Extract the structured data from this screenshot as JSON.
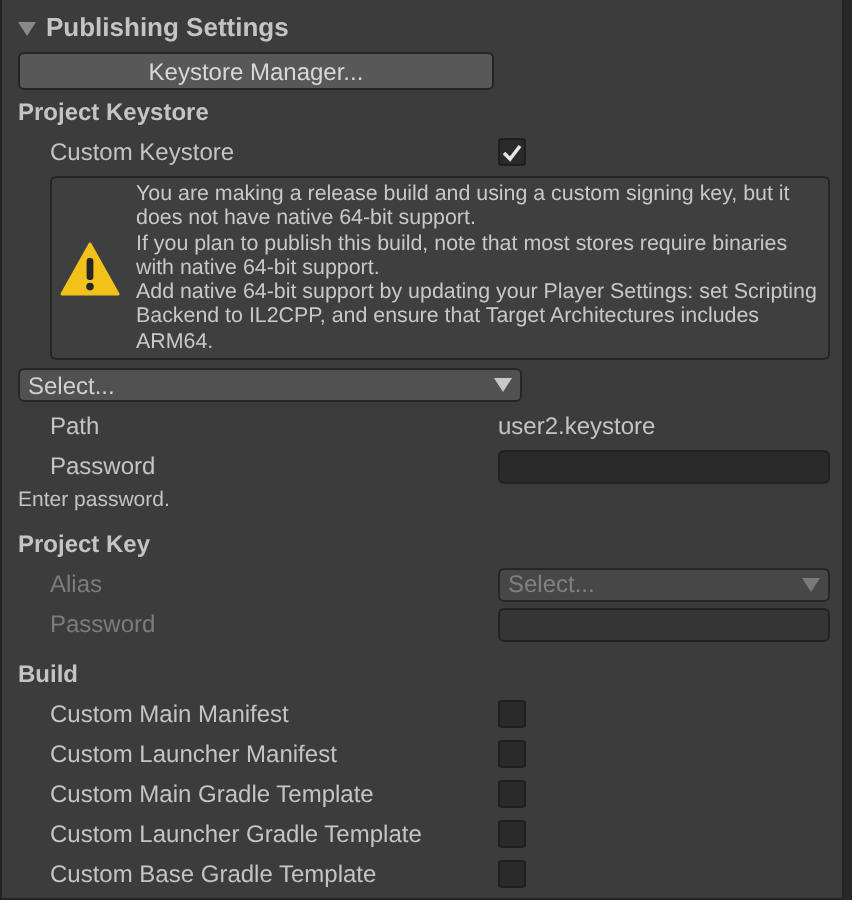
{
  "section": {
    "title": "Publishing Settings",
    "expanded": true
  },
  "keystore_manager_button": "Keystore Manager...",
  "project_keystore": {
    "heading": "Project Keystore",
    "custom_keystore": {
      "label": "Custom Keystore",
      "checked": true
    },
    "warning": [
      "You are making a release build and using a custom signing key, but it does not have native 64-bit support.",
      "If you plan to publish this build, note that most stores require binaries with native 64-bit support.",
      "Add native 64-bit support by updating your Player Settings: set Scripting Backend to IL2CPP, and ensure that Target Architectures includes ARM64."
    ],
    "keystore_select": "Select...",
    "path": {
      "label": "Path",
      "value": "user2.keystore"
    },
    "password": {
      "label": "Password"
    },
    "hint": "Enter password."
  },
  "project_key": {
    "heading": "Project Key",
    "disabled": true,
    "alias": {
      "label": "Alias",
      "value": "Select..."
    },
    "password": {
      "label": "Password"
    }
  },
  "build": {
    "heading": "Build",
    "options": [
      {
        "label": "Custom Main Manifest",
        "checked": false
      },
      {
        "label": "Custom Launcher Manifest",
        "checked": false
      },
      {
        "label": "Custom Main Gradle Template",
        "checked": false
      },
      {
        "label": "Custom Launcher Gradle Template",
        "checked": false
      },
      {
        "label": "Custom Base Gradle Template",
        "checked": false
      }
    ]
  }
}
